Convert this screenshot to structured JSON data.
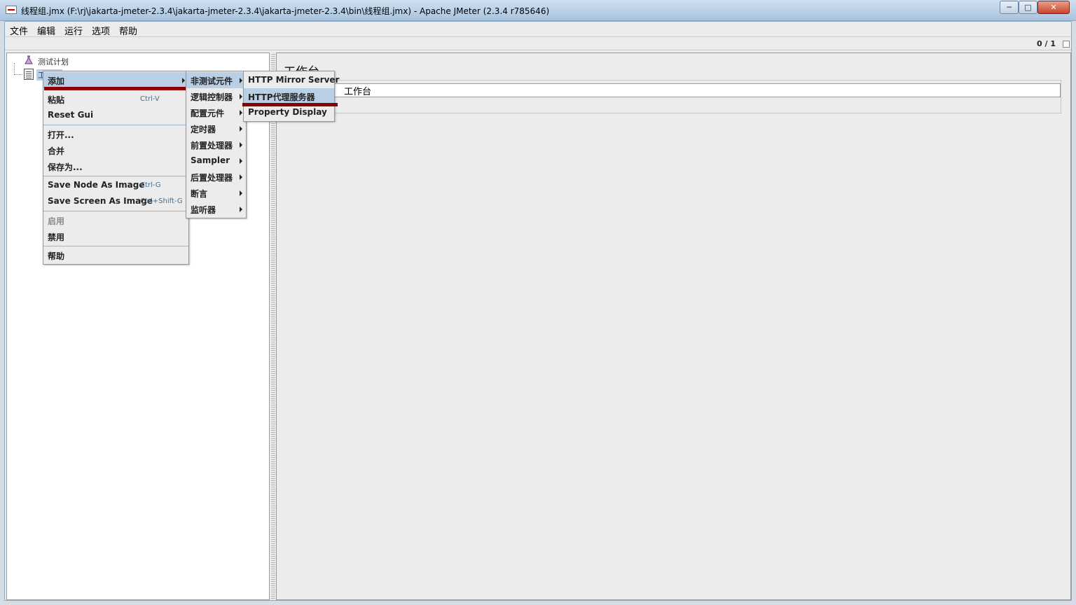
{
  "window": {
    "title": "线程组.jmx (F:\\rj\\jakarta-jmeter-2.3.4\\jakarta-jmeter-2.3.4\\jakarta-jmeter-2.3.4\\bin\\线程组.jmx) - Apache JMeter (2.3.4 r785646)",
    "min_glyph": "─",
    "max_glyph": "□",
    "close_glyph": "✕"
  },
  "menubar": [
    "文件",
    "编辑",
    "运行",
    "选项",
    "帮助"
  ],
  "toolbar": {
    "counter": "0 / 1"
  },
  "tree": {
    "nodes": [
      {
        "label": "测试计划"
      },
      {
        "label": "工作台"
      }
    ]
  },
  "panel": {
    "title": "工作台",
    "name_value": "工作台"
  },
  "context_menu": {
    "items": [
      {
        "label": "添加",
        "submenu": true
      },
      {
        "label": "粘贴",
        "accel": "Ctrl-V"
      },
      {
        "label": "Reset Gui"
      },
      {
        "label": "打开..."
      },
      {
        "label": "合并"
      },
      {
        "label": "保存为..."
      },
      {
        "label": "Save Node As Image",
        "accel": "Ctrl-G"
      },
      {
        "label": "Save Screen As Image",
        "accel": "Ctrl+Shift-G"
      },
      {
        "label": "启用",
        "disabled": true
      },
      {
        "label": "禁用"
      },
      {
        "label": "帮助"
      }
    ]
  },
  "add_menu": {
    "items": [
      "非测试元件",
      "逻辑控制器",
      "配置元件",
      "定时器",
      "前置处理器",
      "Sampler",
      "后置处理器",
      "断言",
      "监听器"
    ]
  },
  "non_test_menu": {
    "items": [
      "HTTP Mirror Server",
      "HTTP代理服务器",
      "Property Display"
    ]
  },
  "colors": {
    "highlight": "#b8cfe5",
    "annotation_red": "#8b0000"
  }
}
